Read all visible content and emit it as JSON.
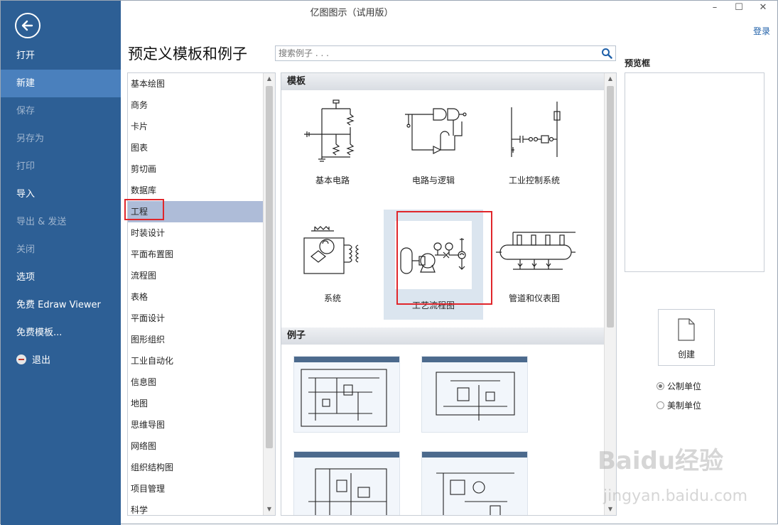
{
  "window": {
    "title": "亿图图示（试用版）",
    "login_label": "登录",
    "minimize": "–",
    "maximize": "☐",
    "close": "✕"
  },
  "nav": {
    "items": [
      {
        "label": "打开"
      },
      {
        "label": "新建"
      },
      {
        "label": "保存"
      },
      {
        "label": "另存为"
      },
      {
        "label": "打印"
      },
      {
        "label": "导入"
      },
      {
        "label": "导出 & 发送"
      },
      {
        "label": "关闭"
      },
      {
        "label": "选项"
      },
      {
        "label": "免费 Edraw Viewer"
      },
      {
        "label": "免费模板..."
      },
      {
        "label": "退出"
      }
    ],
    "active": "新建"
  },
  "main": {
    "heading": "预定义模板和例子",
    "search_placeholder": "搜索例子 . . ."
  },
  "categories": {
    "items": [
      {
        "label": "基本绘图"
      },
      {
        "label": "商务"
      },
      {
        "label": "卡片"
      },
      {
        "label": "图表"
      },
      {
        "label": "剪切画"
      },
      {
        "label": "数据库"
      },
      {
        "label": "工程"
      },
      {
        "label": "时装设计"
      },
      {
        "label": "平面布置图"
      },
      {
        "label": "流程图"
      },
      {
        "label": "表格"
      },
      {
        "label": "平面设计"
      },
      {
        "label": "图形组织"
      },
      {
        "label": "工业自动化"
      },
      {
        "label": "信息图"
      },
      {
        "label": "地图"
      },
      {
        "label": "思维导图"
      },
      {
        "label": "网络图"
      },
      {
        "label": "组织结构图"
      },
      {
        "label": "项目管理"
      },
      {
        "label": "科学"
      }
    ],
    "selected": "工程"
  },
  "templates": {
    "header": "模板",
    "items": [
      {
        "label": "基本电路"
      },
      {
        "label": "电路与逻辑"
      },
      {
        "label": "工业控制系统"
      },
      {
        "label": "系统"
      },
      {
        "label": "工艺流程图"
      },
      {
        "label": "管道和仪表图"
      }
    ],
    "selected": "工艺流程图"
  },
  "examples": {
    "header": "例子"
  },
  "preview": {
    "label": "预览框",
    "create_label": "创建",
    "units": [
      {
        "label": "公制单位",
        "checked": true
      },
      {
        "label": "美制单位",
        "checked": false
      }
    ]
  },
  "watermark": {
    "brand": "Baidu经验",
    "url": "jingyan.baidu.com"
  },
  "colors": {
    "nav_bg": "#2d5f95",
    "nav_active": "#4a80bd",
    "selection": "#aebcd8",
    "highlight_border": "#e0262b",
    "link": "#1e5fa8"
  }
}
